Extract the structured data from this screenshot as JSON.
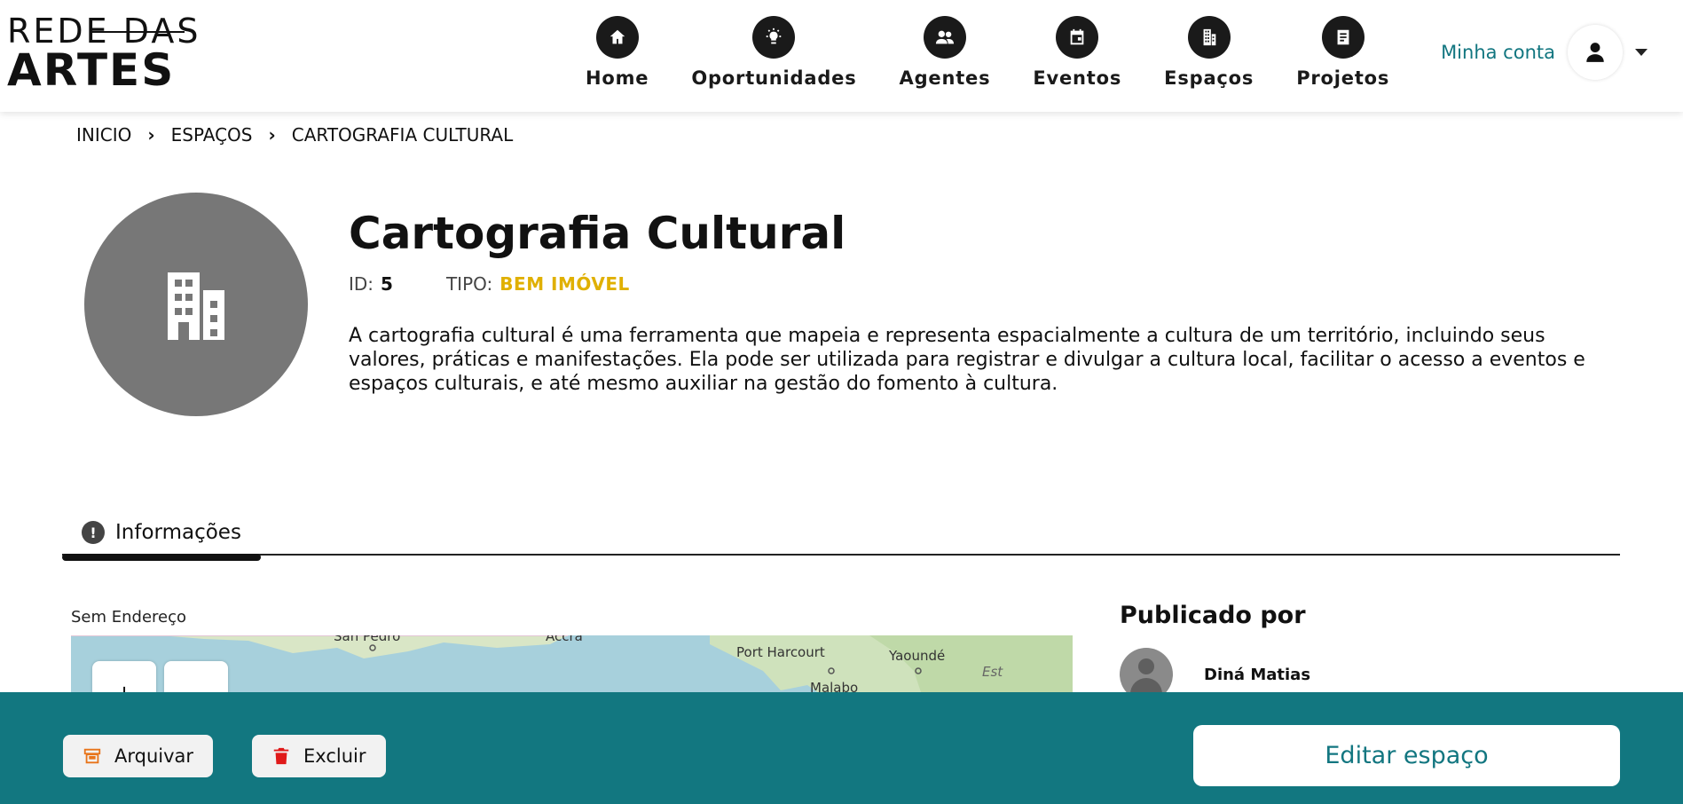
{
  "header": {
    "logo": {
      "line1": "REDE DAS",
      "line2": "ARTES"
    },
    "nav": [
      {
        "label": "Home",
        "icon": "home-icon"
      },
      {
        "label": "Oportunidades",
        "icon": "lightbulb-icon"
      },
      {
        "label": "Agentes",
        "icon": "people-icon"
      },
      {
        "label": "Eventos",
        "icon": "calendar-icon"
      },
      {
        "label": "Espaços",
        "icon": "building-icon"
      },
      {
        "label": "Projetos",
        "icon": "document-icon"
      }
    ],
    "account": {
      "label": "Minha conta",
      "icon": "user-icon"
    }
  },
  "breadcrumb": [
    "INICIO",
    "ESPAÇOS",
    "CARTOGRAFIA CULTURAL"
  ],
  "space": {
    "title": "Cartografia Cultural",
    "id_label": "ID:",
    "id_value": "5",
    "type_label": "TIPO:",
    "type_value": "BEM IMÓVEL",
    "description": "A cartografia cultural é uma ferramenta que mapeia e representa espacialmente a cultura de um território, incluindo seus valores, práticas e manifestações. Ela pode ser utilizada para registrar e divulgar a cultura local, facilitar o acesso a eventos e espaços culturais, e até mesmo auxiliar na gestão do fomento à cultura.",
    "avatar_icon": "building-icon"
  },
  "tabs": [
    {
      "label": "Informações",
      "icon": "info-icon",
      "active": true
    }
  ],
  "location": {
    "address": "Sem Endereço",
    "map_labels": [
      "San Pedro",
      "Accra",
      "Port Harcourt",
      "Yaoundé",
      "Est",
      "Malabo"
    ],
    "zoom_in": "+",
    "zoom_out": "−"
  },
  "published_by": {
    "title": "Publicado por",
    "name": "Diná Matias"
  },
  "footer": {
    "archive_label": "Arquivar",
    "delete_label": "Excluir",
    "edit_label": "Editar espaço"
  },
  "colors": {
    "teal": "#127780",
    "type_yellow": "#e0b000",
    "avatar_gray": "#777777"
  }
}
